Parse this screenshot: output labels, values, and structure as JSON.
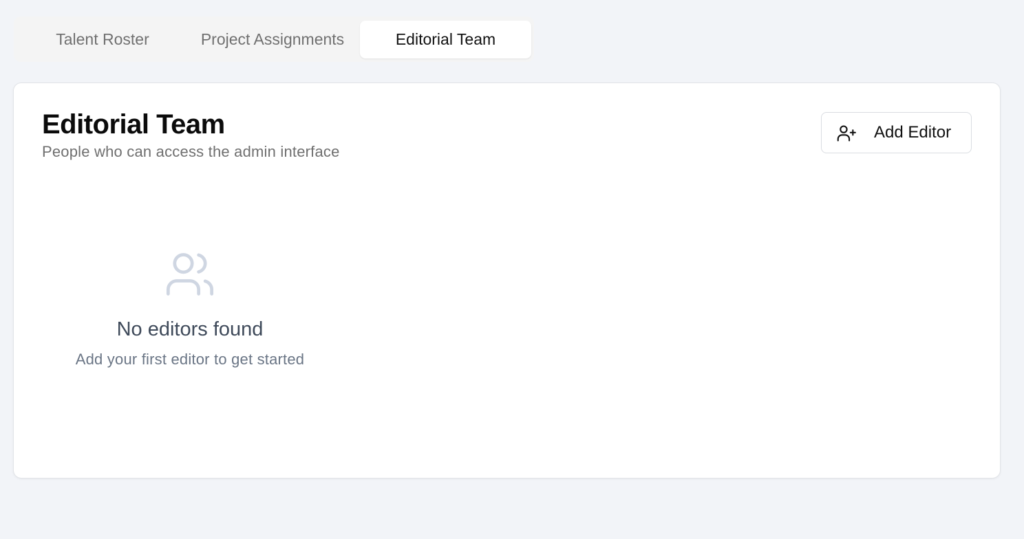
{
  "tabs": [
    {
      "label": "Talent Roster",
      "active": false
    },
    {
      "label": "Project Assignments",
      "active": false
    },
    {
      "label": "Editorial Team",
      "active": true
    }
  ],
  "card": {
    "title": "Editorial Team",
    "subtitle": "People who can access the admin interface",
    "add_button": {
      "label": "Add Editor",
      "icon": "user-plus-icon"
    }
  },
  "empty_state": {
    "icon": "users-icon",
    "title": "No editors found",
    "subtitle": "Add your first editor to get started"
  },
  "colors": {
    "background": "#f2f4f8",
    "card": "#ffffff",
    "empty_icon": "#cfd6e2",
    "empty_title": "#3f4a5a",
    "empty_subtitle": "#6a7585"
  }
}
